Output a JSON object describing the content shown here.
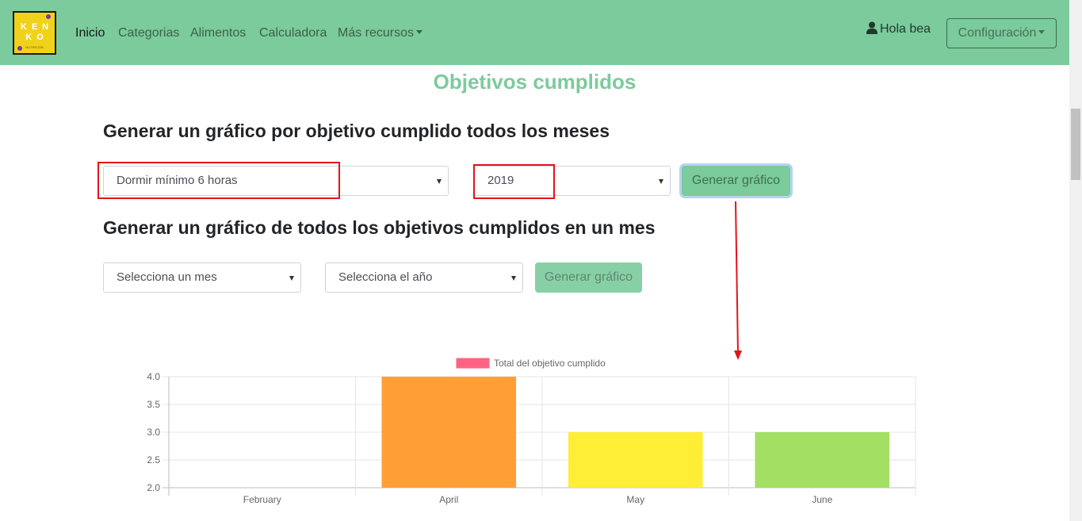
{
  "navbar": {
    "logo": {
      "line1": "KEN",
      "line2": "KO",
      "line3": "NUTRICIÓN"
    },
    "links": [
      "Inicio",
      "Categorias",
      "Alimentos",
      "Calculadora",
      "Más recursos"
    ],
    "user_label": "Hola bea",
    "config_label": "Configuración",
    "colors": {
      "background": "#7bcb9c"
    }
  },
  "page": {
    "title": "Objetivos cumplidos"
  },
  "section1": {
    "heading": "Generar un gráfico por objetivo cumplido todos los meses",
    "objective_select": "Dormir mínimo 6 horas",
    "year_select": "2019",
    "button_label": "Generar gráfico"
  },
  "section2": {
    "heading": "Generar un gráfico de todos los objetivos cumplidos en un mes",
    "month_select": "Selecciona un mes",
    "year_select": "Selecciona el año",
    "button_label": "Generar gráfico"
  },
  "chart_data": {
    "type": "bar",
    "categories": [
      "February",
      "April",
      "May",
      "June"
    ],
    "series": [
      {
        "name": "Total del objetivo cumplido",
        "values": [
          2,
          4,
          3,
          3
        ],
        "colors": [
          "#ff6384",
          "#ff9f36",
          "#ffee36",
          "#a3df63"
        ]
      }
    ],
    "legend_color": "#ff6384",
    "ylim": [
      2.0,
      4.0
    ],
    "yticks": [
      "4.0",
      "3.5",
      "3.0",
      "2.5",
      "2.0"
    ],
    "grid": true,
    "legend_position": "top"
  }
}
